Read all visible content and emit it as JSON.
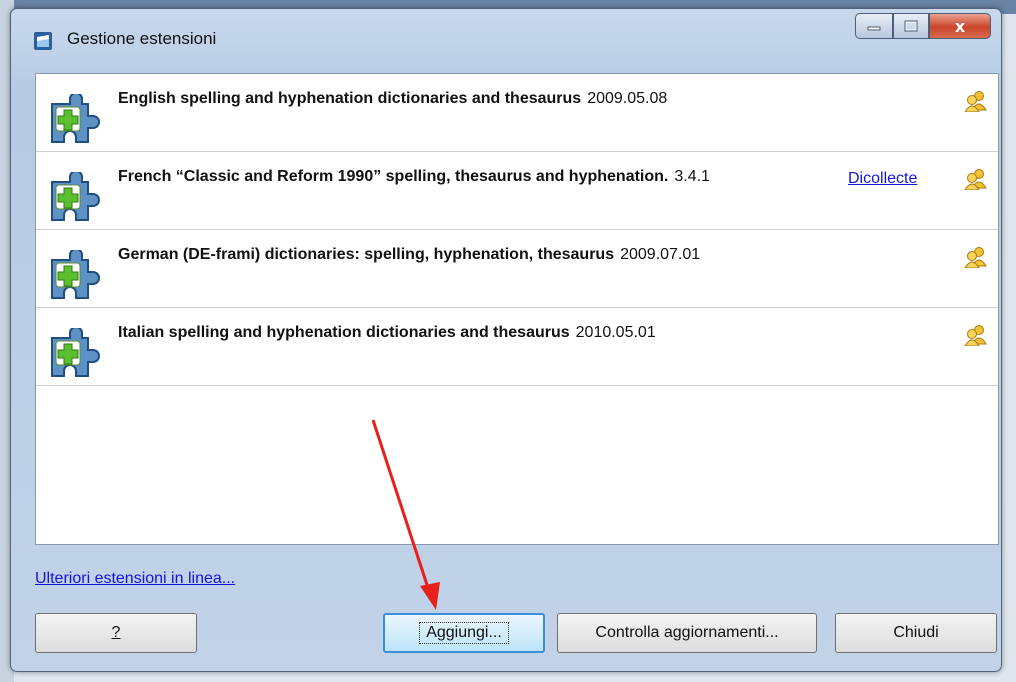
{
  "window": {
    "title": "Gestione estensioni",
    "caption_buttons": {
      "minimize": "minimize",
      "maximize": "maximize",
      "close": "x"
    }
  },
  "extensions": [
    {
      "name": "English spelling and hyphenation dictionaries and thesaurus",
      "version": "2009.05.08",
      "publisher": ""
    },
    {
      "name": "French “Classic and Reform 1990” spelling, thesaurus and hyphenation.",
      "version": "3.4.1",
      "publisher": "Dicollecte"
    },
    {
      "name": "German (DE-frami) dictionaries: spelling, hyphenation, thesaurus",
      "version": "2009.07.01",
      "publisher": ""
    },
    {
      "name": "Italian spelling and hyphenation dictionaries and thesaurus",
      "version": "2010.05.01",
      "publisher": ""
    }
  ],
  "more_extensions_link": "Ulteriori estensioni in linea...",
  "buttons": {
    "help": "?",
    "add": "Aggiungi...",
    "check_updates": "Controlla aggiornamenti...",
    "close": "Chiudi"
  },
  "colors": {
    "link": "#1414d6",
    "arrow": "#e8201a"
  }
}
